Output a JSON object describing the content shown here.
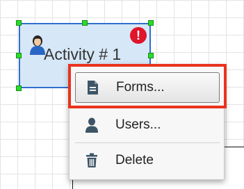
{
  "activity": {
    "label": "Activity # 1",
    "icon": "user-icon",
    "warning": {
      "icon": "exclamation-icon",
      "glyph": "!",
      "color": "#e0142a"
    },
    "fill_color": "#d6e7f7",
    "border_color": "#2f6fd0",
    "handle_color": "#2bdc2b"
  },
  "context_menu": {
    "items": [
      {
        "label": "Forms...",
        "icon": "document-icon",
        "highlighted": true
      },
      {
        "label": "Users...",
        "icon": "user-icon"
      },
      {
        "label": "Delete",
        "icon": "trash-icon"
      }
    ],
    "highlight_color": "#e9331e"
  }
}
